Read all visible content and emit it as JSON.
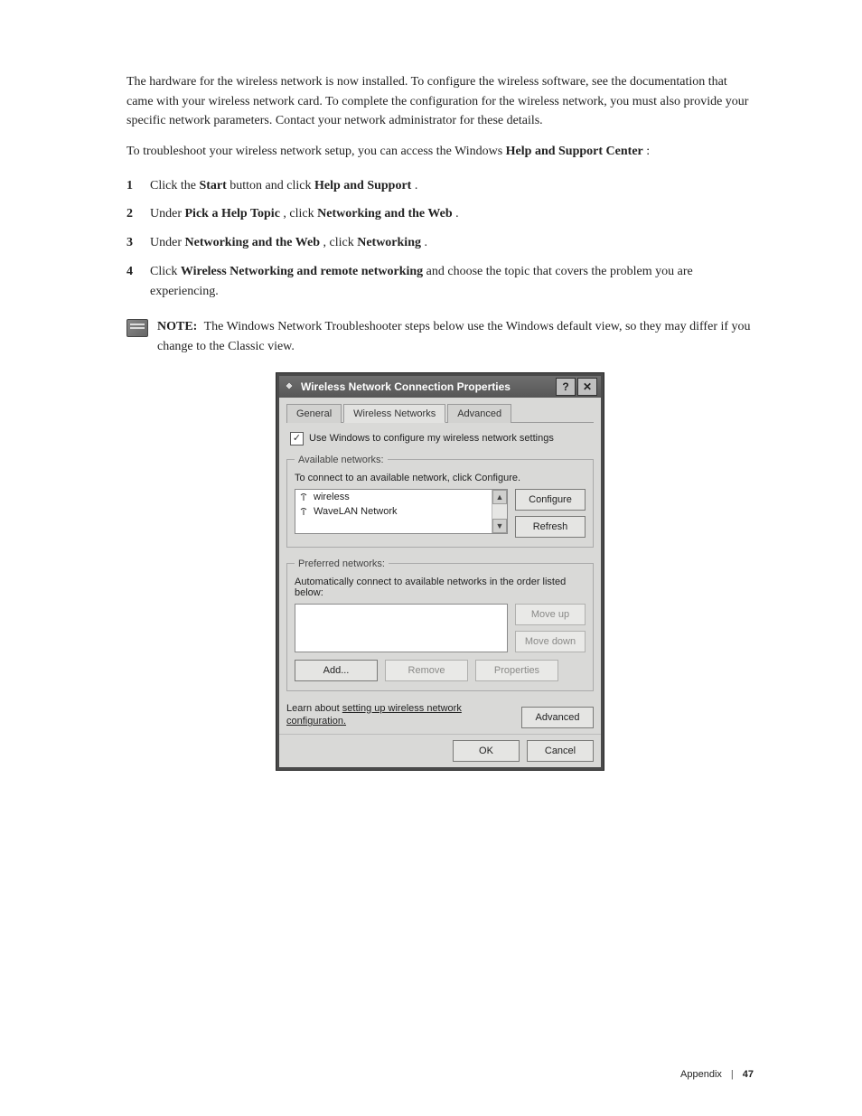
{
  "body": {
    "p1": "The hardware for the wireless network is now installed. To configure the wireless software, see the documentation that came with your wireless network card. To complete the configuration for the wireless network, you must also provide your specific network parameters. Contact your network administrator for these details.",
    "p2_before": "To troubleshoot your wireless network setup, you can access the Windows ",
    "p2_help": "Help and Support Center",
    "p2_after": ":"
  },
  "steps": [
    {
      "n": "1",
      "text_before": "Click the ",
      "bold1": "Start",
      "mid": " button and click ",
      "bold2": "Help and Support",
      "after": "."
    },
    {
      "n": "2",
      "text_before": "Under ",
      "bold1": "Pick a Help Topic",
      "mid": ", click ",
      "bold2": "Networking and the Web",
      "after": "."
    },
    {
      "n": "3",
      "text_before": "Under ",
      "bold1": "Networking and the Web",
      "mid": ", click ",
      "bold2": "Networking",
      "after": "."
    },
    {
      "n": "4",
      "text_before": "Click ",
      "bold1": "Wireless Networking and remote networking",
      "mid": " ",
      "bold2": "",
      "after": "and choose the topic that covers the problem you are experiencing."
    }
  ],
  "note": {
    "label": "NOTE:",
    "text": "The Windows Network Troubleshooter steps below use the Windows default view, so they may differ if you change to the Classic view."
  },
  "dialog": {
    "title": "Wireless Network Connection Properties",
    "tabs": {
      "general": "General",
      "wireless": "Wireless Networks",
      "advanced": "Advanced"
    },
    "checkbox_label": "Use Windows to configure my wireless network settings",
    "available": {
      "legend": "Available networks:",
      "hint": "To connect to an available network, click Configure.",
      "items": [
        "wireless",
        "WaveLAN Network"
      ],
      "configure": "Configure",
      "refresh": "Refresh"
    },
    "preferred": {
      "legend": "Preferred networks:",
      "hint": "Automatically connect to available networks in the order listed below:",
      "moveup": "Move up",
      "movedown": "Move down",
      "add": "Add...",
      "remove": "Remove",
      "properties": "Properties"
    },
    "learn_prefix": "Learn about ",
    "learn_link": "setting up wireless network configuration.",
    "advanced_btn": "Advanced",
    "ok": "OK",
    "cancel": "Cancel"
  },
  "footer": {
    "section": "Appendix",
    "page": "47"
  }
}
